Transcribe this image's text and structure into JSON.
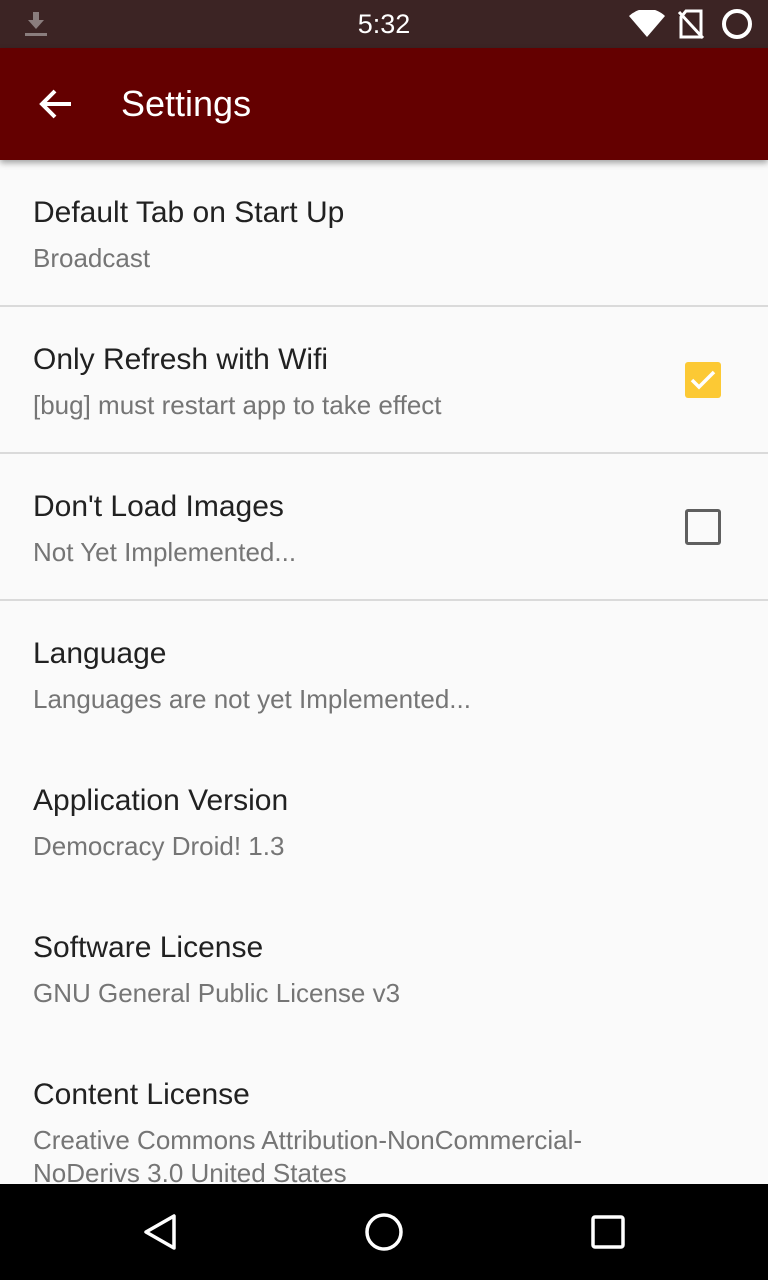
{
  "status_bar": {
    "time": "5:32",
    "icons": [
      "download-icon",
      "wifi-icon",
      "no-sim-icon",
      "sync-circle-icon"
    ]
  },
  "app_bar": {
    "title": "Settings",
    "background_color": "#640000",
    "back_icon": "arrow-back-icon"
  },
  "preferences": [
    {
      "title": "Default Tab on Start Up",
      "summary": "Broadcast"
    },
    {
      "title": "Only Refresh with Wifi",
      "summary": "[bug] must restart app to take effect",
      "checked": true
    },
    {
      "title": "Don't Load Images",
      "summary": "Not Yet Implemented...",
      "checked": false
    },
    {
      "title": "Language",
      "summary": "Languages are not yet Implemented..."
    },
    {
      "title": "Application Version",
      "summary": "Democracy Droid! 1.3"
    },
    {
      "title": "Software License",
      "summary": "GNU General Public License v3"
    },
    {
      "title": "Content License",
      "summary": "Creative Commons Attribution-NonCommercial-NoDerivs 3.0 United States"
    }
  ],
  "colors": {
    "accent": "#fcc934",
    "status_bar": "#3c2424"
  },
  "nav_bar": {
    "icons": [
      "back-triangle-icon",
      "home-circle-icon",
      "recents-square-icon"
    ]
  }
}
